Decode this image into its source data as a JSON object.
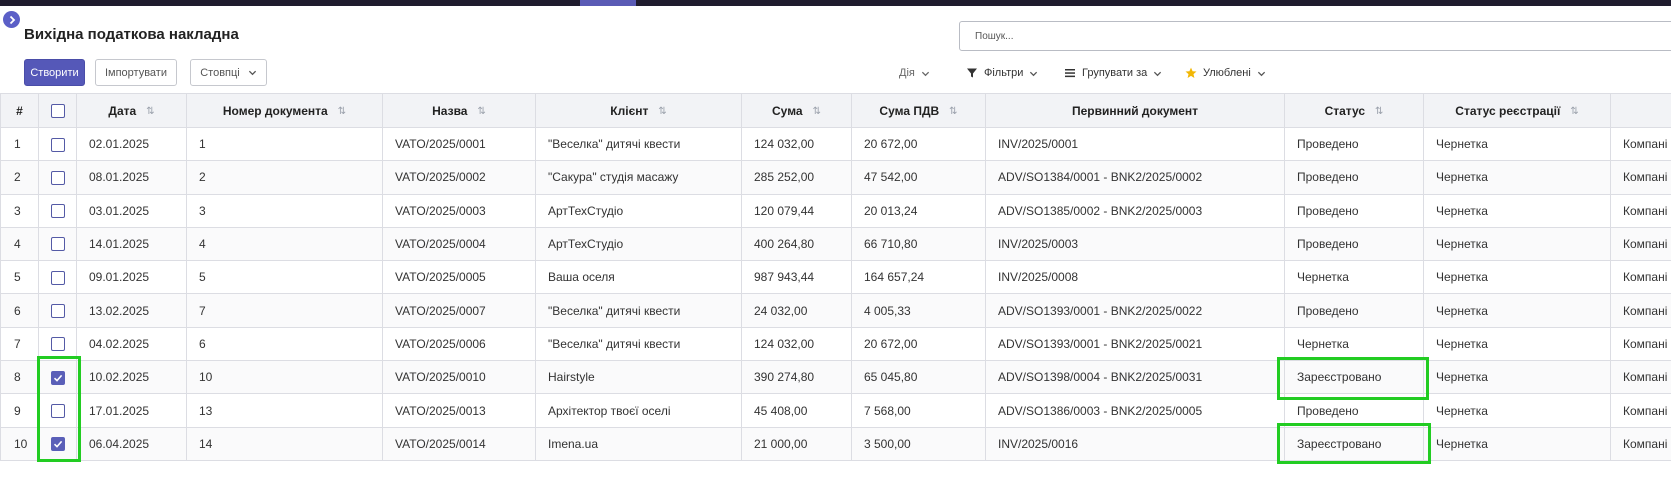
{
  "page": {
    "title": "Вихідна податкова накладна"
  },
  "search": {
    "placeholder": "Пошук..."
  },
  "toolbar": {
    "create_label": "Створити",
    "import_label": "Імпортувати",
    "columns_label": "Стовпці",
    "action_label": "Дія",
    "filters_label": "Фільтри",
    "group_label": "Групувати за",
    "favorites_label": "Улюблені"
  },
  "colors": {
    "accent": "#5558b8",
    "highlight": "#22cc22"
  },
  "table": {
    "headers": {
      "index": "#",
      "date": "Дата",
      "doc_number": "Номер документа",
      "name": "Назва",
      "client": "Клієнт",
      "amount": "Сума",
      "vat": "Сума ПДВ",
      "primary_doc": "Первинний документ",
      "status": "Статус",
      "reg_status": "Статус реєстрації"
    },
    "rows": [
      {
        "idx": "1",
        "checked": false,
        "date": "02.01.2025",
        "doc": "1",
        "name": "VATO/2025/0001",
        "client": "\"Веселка\" дитячі квести",
        "amount": "124 032,00",
        "vat": "20 672,00",
        "primary": "INV/2025/0001",
        "status": "Проведено",
        "reg": "Чернетка",
        "company": "Компані"
      },
      {
        "idx": "2",
        "checked": false,
        "date": "08.01.2025",
        "doc": "2",
        "name": "VATO/2025/0002",
        "client": "\"Сакура\" студія масажу",
        "amount": "285 252,00",
        "vat": "47 542,00",
        "primary": "ADV/SO1384/0001 - BNK2/2025/0002",
        "status": "Проведено",
        "reg": "Чернетка",
        "company": "Компані"
      },
      {
        "idx": "3",
        "checked": false,
        "date": "03.01.2025",
        "doc": "3",
        "name": "VATO/2025/0003",
        "client": "АртТехСтудіо",
        "amount": "120 079,44",
        "vat": "20 013,24",
        "primary": "ADV/SO1385/0002 - BNK2/2025/0003",
        "status": "Проведено",
        "reg": "Чернетка",
        "company": "Компані"
      },
      {
        "idx": "4",
        "checked": false,
        "date": "14.01.2025",
        "doc": "4",
        "name": "VATO/2025/0004",
        "client": "АртТехСтудіо",
        "amount": "400 264,80",
        "vat": "66 710,80",
        "primary": "INV/2025/0003",
        "status": "Проведено",
        "reg": "Чернетка",
        "company": "Компані"
      },
      {
        "idx": "5",
        "checked": false,
        "date": "09.01.2025",
        "doc": "5",
        "name": "VATO/2025/0005",
        "client": "Ваша оселя",
        "amount": "987 943,44",
        "vat": "164 657,24",
        "primary": "INV/2025/0008",
        "status": "Чернетка",
        "reg": "Чернетка",
        "company": "Компані"
      },
      {
        "idx": "6",
        "checked": false,
        "date": "13.02.2025",
        "doc": "7",
        "name": "VATO/2025/0007",
        "client": "\"Веселка\" дитячі квести",
        "amount": "24 032,00",
        "vat": "4 005,33",
        "primary": "ADV/SO1393/0001 - BNK2/2025/0022",
        "status": "Проведено",
        "reg": "Чернетка",
        "company": "Компані"
      },
      {
        "idx": "7",
        "checked": false,
        "date": "04.02.2025",
        "doc": "6",
        "name": "VATO/2025/0006",
        "client": "\"Веселка\" дитячі квести",
        "amount": "124 032,00",
        "vat": "20 672,00",
        "primary": "ADV/SO1393/0001 - BNK2/2025/0021",
        "status": "Чернетка",
        "reg": "Чернетка",
        "company": "Компані"
      },
      {
        "idx": "8",
        "checked": true,
        "date": "10.02.2025",
        "doc": "10",
        "name": "VATO/2025/0010",
        "client": "Hairstyle",
        "amount": "390 274,80",
        "vat": "65 045,80",
        "primary": "ADV/SO1398/0004 - BNK2/2025/0031",
        "status": "Зареєстровано",
        "reg": "Чернетка",
        "company": "Компані"
      },
      {
        "idx": "9",
        "checked": false,
        "date": "17.01.2025",
        "doc": "13",
        "name": "VATO/2025/0013",
        "client": "Архітектор твоєї оселі",
        "amount": "45 408,00",
        "vat": "7 568,00",
        "primary": "ADV/SO1386/0003 - BNK2/2025/0005",
        "status": "Проведено",
        "reg": "Чернетка",
        "company": "Компані"
      },
      {
        "idx": "10",
        "checked": true,
        "date": "06.04.2025",
        "doc": "14",
        "name": "VATO/2025/0014",
        "client": "Imena.ua",
        "amount": "21 000,00",
        "vat": "3 500,00",
        "primary": "INV/2025/0016",
        "status": "Зареєстровано",
        "reg": "Чернетка",
        "company": "Компані"
      }
    ]
  }
}
